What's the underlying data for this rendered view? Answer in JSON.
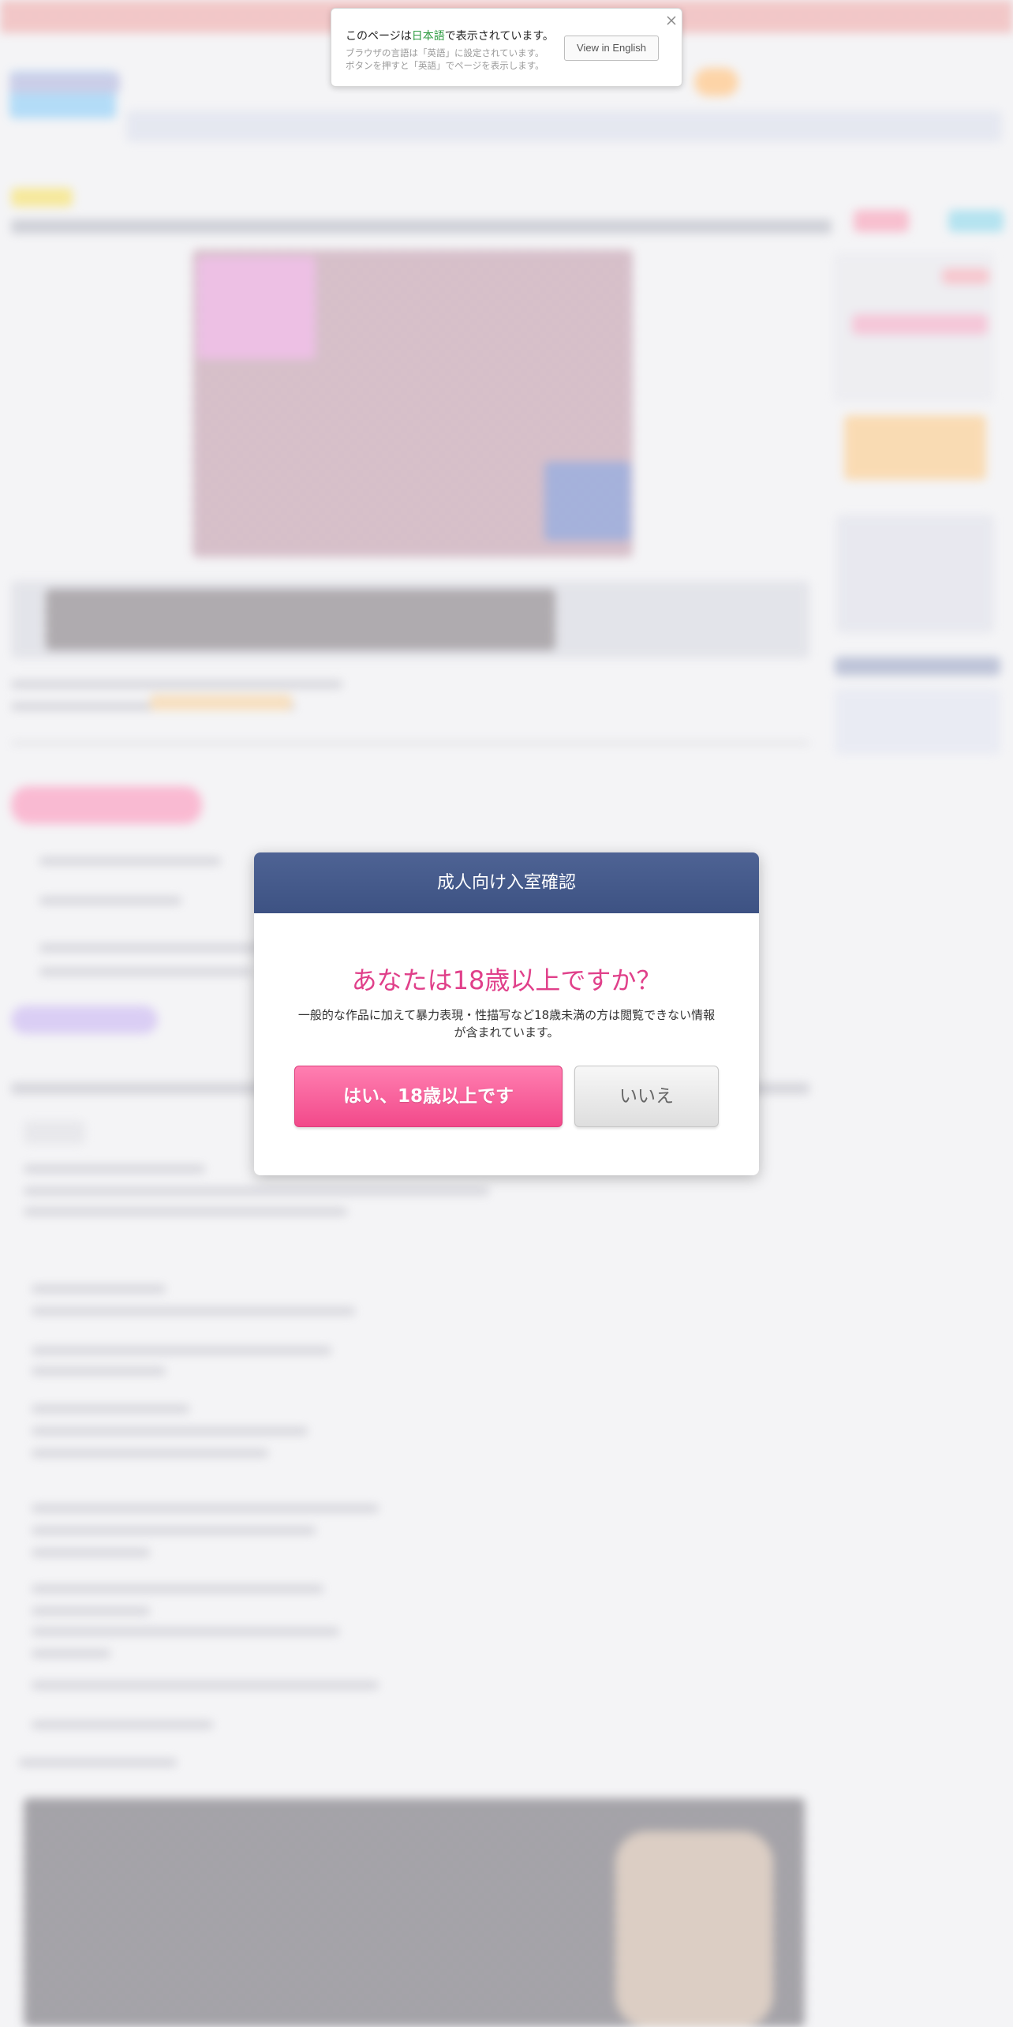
{
  "language_banner": {
    "message_before": "このページは",
    "message_highlight": "日本語",
    "message_after": "で表示されています。",
    "sub_line_1": "ブラウザの言語は「英語」に設定されています。",
    "sub_line_2": "ボタンを押すと「英語」でページを表示します。",
    "button_label": "View in English",
    "close_icon": "close-icon"
  },
  "age_modal": {
    "title": "成人向け入室確認",
    "question": "あなたは18歳以上ですか？",
    "description": "一般的な作品に加えて暴力表現・性描写など18歳未満の方は閲覧できない情報が含まれています。",
    "yes_label": "はい、18歳以上です",
    "no_label": "いいえ"
  },
  "colors": {
    "header_bar": "#4e6394",
    "question_pink": "#e0408a",
    "yes_button": "#f2498a",
    "highlight_green": "#2c9a3f"
  }
}
